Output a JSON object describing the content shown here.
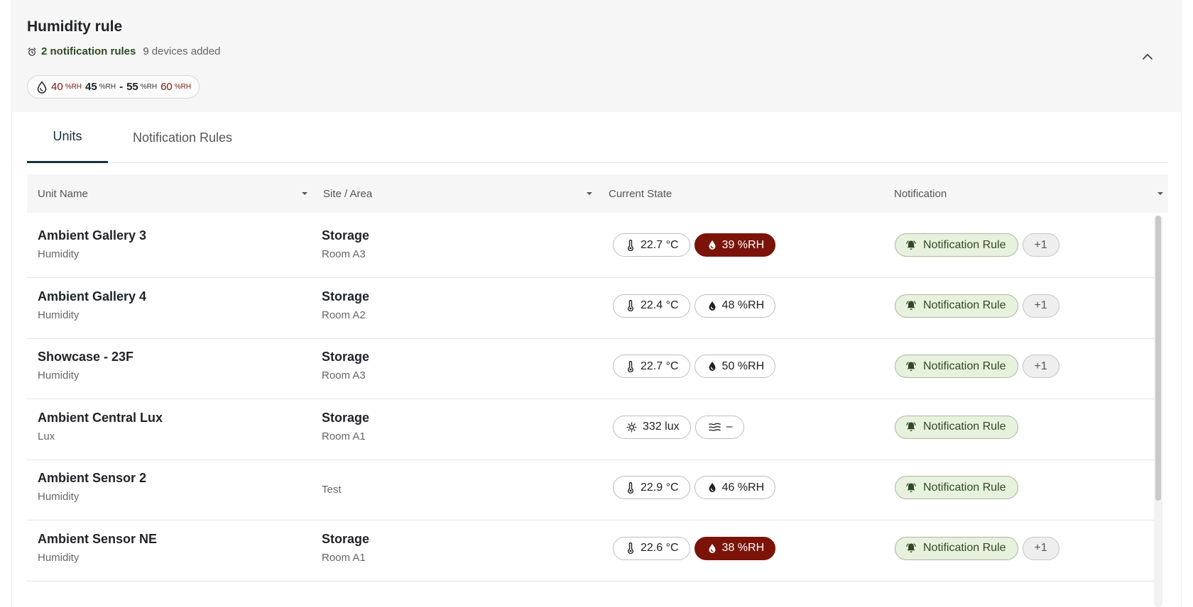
{
  "header": {
    "title": "Humidity rule",
    "rules_count": "2 notification rules",
    "devices_count": "9",
    "devices_label": "devices added"
  },
  "range": {
    "low_alarm": "40",
    "low_warn": "45",
    "dash": "-",
    "high_warn": "55",
    "high_alarm": "60",
    "unit": "%RH"
  },
  "tabs": [
    {
      "label": "Units",
      "active": true
    },
    {
      "label": "Notification Rules",
      "active": false
    }
  ],
  "columns": {
    "unit_name": "Unit Name",
    "site_area": "Site / Area",
    "current_state": "Current State",
    "notification": "Notification"
  },
  "rows": [
    {
      "name": "Ambient Gallery 3",
      "type": "Humidity",
      "site": "Storage",
      "area": "Room A3",
      "chips": [
        {
          "icon": "thermometer-icon",
          "text": "22.7 °C",
          "alert": false
        },
        {
          "icon": "humidity-drop-icon",
          "text": "39 %RH",
          "alert": true
        }
      ],
      "notification": "Notification Rule",
      "extra": "+1"
    },
    {
      "name": "Ambient Gallery 4",
      "type": "Humidity",
      "site": "Storage",
      "area": "Room A2",
      "chips": [
        {
          "icon": "thermometer-icon",
          "text": "22.4 °C",
          "alert": false
        },
        {
          "icon": "humidity-drop-icon",
          "text": "48 %RH",
          "alert": false
        }
      ],
      "notification": "Notification Rule",
      "extra": "+1"
    },
    {
      "name": "Showcase - 23F",
      "type": "Humidity",
      "site": "Storage",
      "area": "Room A3",
      "chips": [
        {
          "icon": "thermometer-icon",
          "text": "22.7 °C",
          "alert": false
        },
        {
          "icon": "humidity-drop-icon",
          "text": "50 %RH",
          "alert": false
        }
      ],
      "notification": "Notification Rule",
      "extra": "+1"
    },
    {
      "name": "Ambient Central Lux",
      "type": "Lux",
      "site": "Storage",
      "area": "Room A1",
      "chips": [
        {
          "icon": "sun-icon",
          "text": "332 lux",
          "alert": false
        },
        {
          "icon": "uv-waves-icon",
          "text": "–",
          "alert": false
        }
      ],
      "notification": "Notification Rule",
      "extra": ""
    },
    {
      "name": "Ambient Sensor 2",
      "type": "Humidity",
      "site": "",
      "area": "Test",
      "chips": [
        {
          "icon": "thermometer-icon",
          "text": "22.9 °C",
          "alert": false
        },
        {
          "icon": "humidity-drop-icon",
          "text": "46 %RH",
          "alert": false
        }
      ],
      "notification": "Notification Rule",
      "extra": ""
    },
    {
      "name": "Ambient Sensor NE",
      "type": "Humidity",
      "site": "Storage",
      "area": "Room A1",
      "chips": [
        {
          "icon": "thermometer-icon",
          "text": "22.6 °C",
          "alert": false
        },
        {
          "icon": "humidity-drop-icon",
          "text": "38 %RH",
          "alert": true
        }
      ],
      "notification": "Notification Rule",
      "extra": "+1"
    }
  ],
  "colors": {
    "alert_red": "#7b1309",
    "rule_green_bg": "#e8f1de",
    "rule_green_text": "#2f4a24",
    "tab_active": "#16323b"
  }
}
